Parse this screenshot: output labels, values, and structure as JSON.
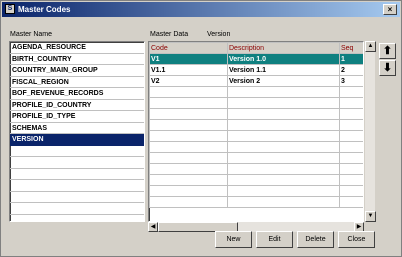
{
  "window": {
    "title": "Master Codes",
    "close_glyph": "×"
  },
  "master_name_label": "Master Name",
  "master_list": [
    "AGENDA_RESOURCE",
    "BIRTH_COUNTRY",
    "COUNTRY_MAIN_GROUP",
    "FISCAL_REGION",
    "BOF_REVENUE_RECORDS",
    "PROFILE_ID_COUNTRY",
    "PROFILE_ID_TYPE",
    "SCHEMAS",
    "VERSION"
  ],
  "selected_master": "VERSION",
  "master_data_label": "Master Data",
  "master_data_value": "Version",
  "grid": {
    "headers": {
      "code": "Code",
      "description": "Description",
      "seq": "Seq"
    },
    "rows": [
      {
        "code": "V1",
        "description": "Version 1.0",
        "seq": "1"
      },
      {
        "code": "V1.1",
        "description": "Version 1.1",
        "seq": "2"
      },
      {
        "code": "V2",
        "description": "Version 2",
        "seq": "3"
      }
    ],
    "selected_row": 0
  },
  "buttons": {
    "new": "New",
    "edit": "Edit",
    "delete": "Delete",
    "close": "Close"
  },
  "colors": {
    "title_start": "#0a246a",
    "selected_list": "#0a246a",
    "selected_row": "#0f8080",
    "header_text": "#8b0000"
  }
}
